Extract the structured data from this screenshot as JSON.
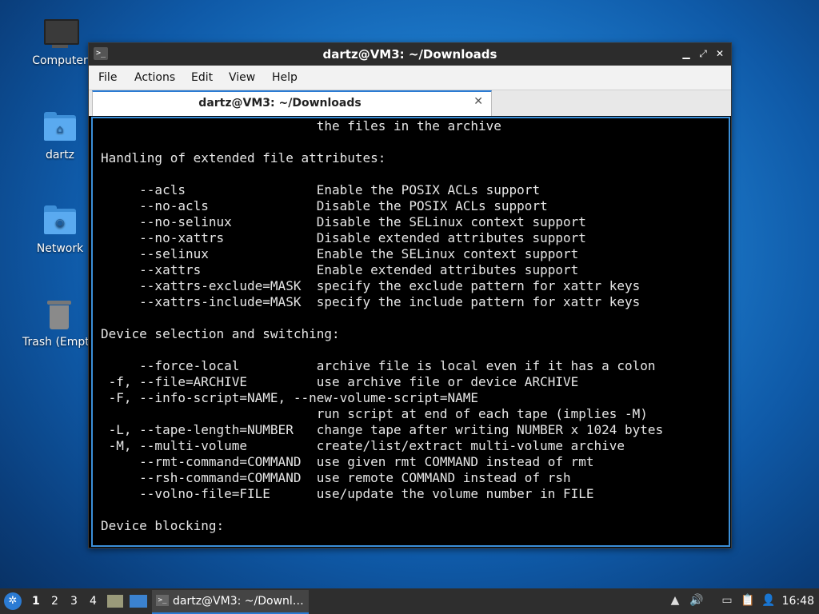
{
  "desktop": {
    "icons": [
      {
        "label": "Computer"
      },
      {
        "label": "dartz"
      },
      {
        "label": "Network"
      },
      {
        "label": "Trash (Empty)"
      }
    ]
  },
  "window": {
    "title": "dartz@VM3: ~/Downloads",
    "controls": {
      "minimize": "▁",
      "maximize": "⤢",
      "close": "✕"
    },
    "menu": [
      "File",
      "Actions",
      "Edit",
      "View",
      "Help"
    ],
    "tab": {
      "label": "dartz@VM3: ~/Downloads",
      "close": "✕"
    }
  },
  "terminal": {
    "lines": [
      "                            the files in the archive",
      "",
      "Handling of extended file attributes:",
      "",
      "     --acls                 Enable the POSIX ACLs support",
      "     --no-acls              Disable the POSIX ACLs support",
      "     --no-selinux           Disable the SELinux context support",
      "     --no-xattrs            Disable extended attributes support",
      "     --selinux              Enable the SELinux context support",
      "     --xattrs               Enable extended attributes support",
      "     --xattrs-exclude=MASK  specify the exclude pattern for xattr keys",
      "     --xattrs-include=MASK  specify the include pattern for xattr keys",
      "",
      "Device selection and switching:",
      "",
      "     --force-local          archive file is local even if it has a colon",
      " -f, --file=ARCHIVE         use archive file or device ARCHIVE",
      " -F, --info-script=NAME, --new-volume-script=NAME",
      "                            run script at end of each tape (implies -M)",
      " -L, --tape-length=NUMBER   change tape after writing NUMBER x 1024 bytes",
      " -M, --multi-volume         create/list/extract multi-volume archive",
      "     --rmt-command=COMMAND  use given rmt COMMAND instead of rmt",
      "     --rsh-command=COMMAND  use remote COMMAND instead of rsh",
      "     --volno-file=FILE      use/update the volume number in FILE",
      "",
      "Device blocking:"
    ]
  },
  "panel": {
    "workspaces": [
      "1",
      "2",
      "3",
      "4"
    ],
    "task_label": "dartz@VM3: ~/Downl…",
    "clock": "16:48"
  },
  "colors": {
    "accent": "#2b7bd3",
    "titlebar": "#2c2c2c",
    "panel": "#2e2e2e"
  }
}
